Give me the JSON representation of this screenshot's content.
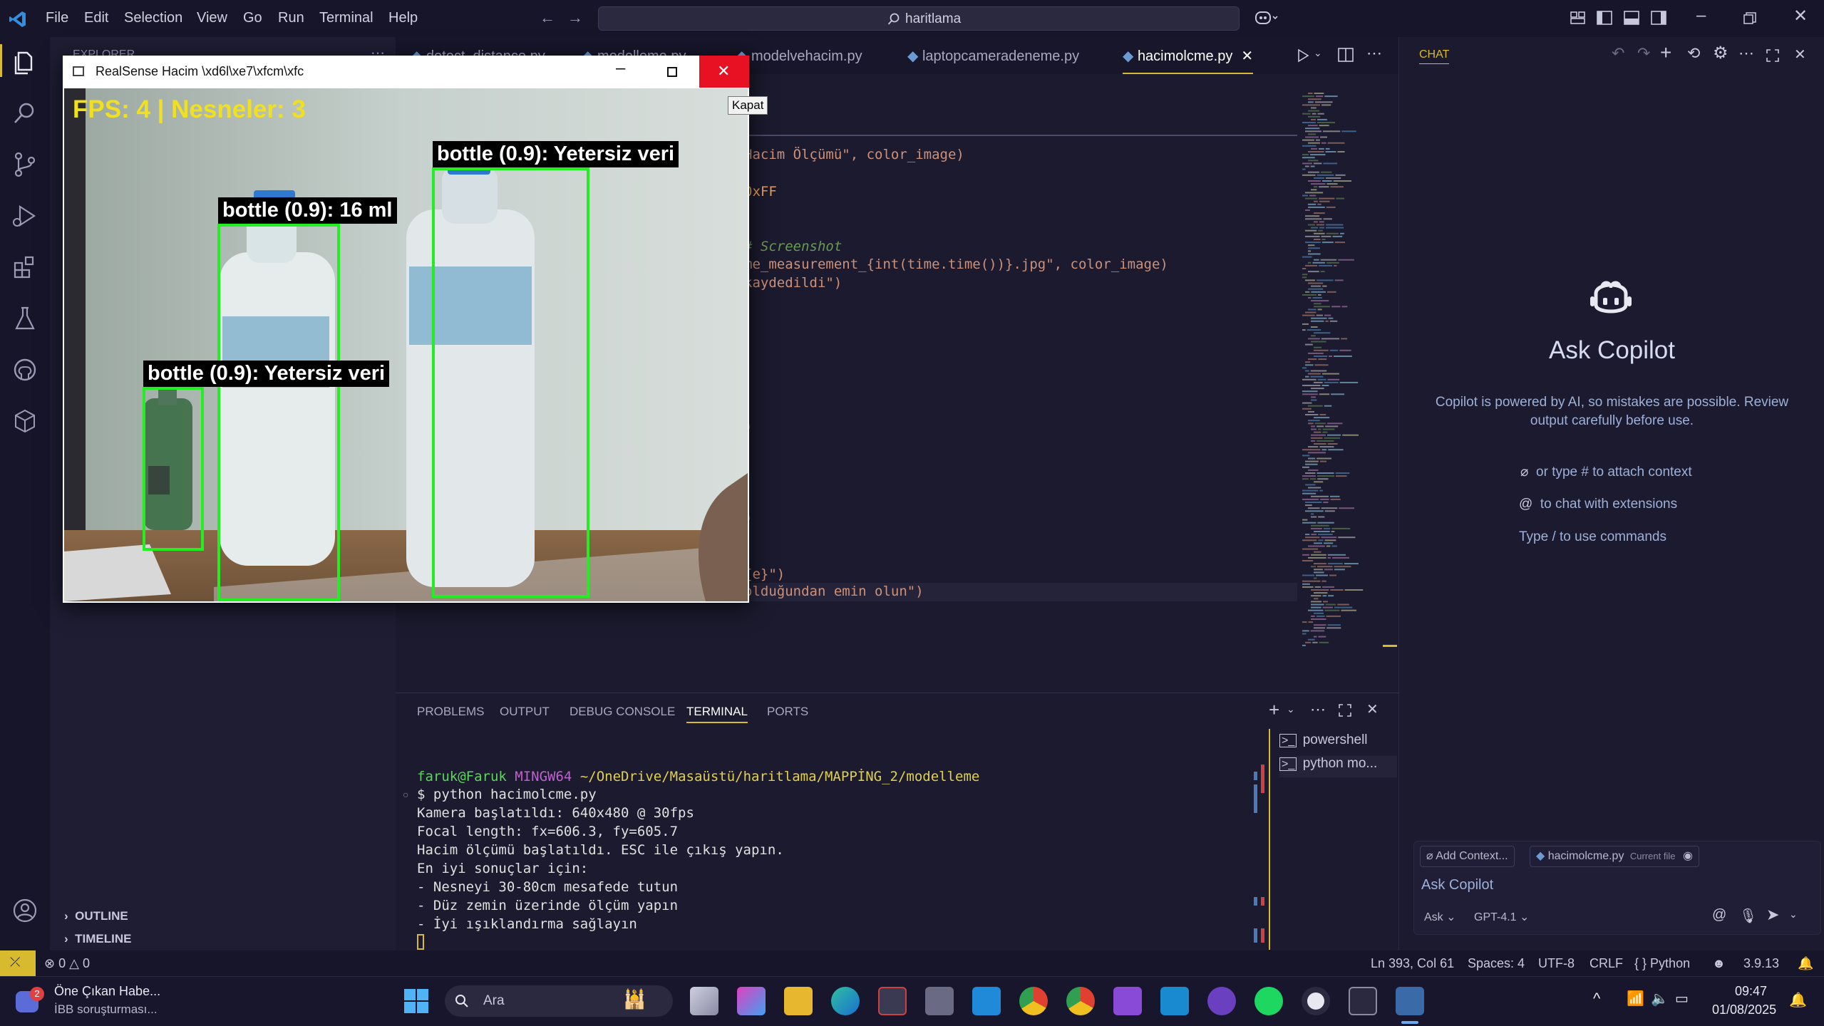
{
  "titlebar": {
    "menu": [
      "File",
      "Edit",
      "Selection",
      "View",
      "Go",
      "Run",
      "Terminal",
      "Help"
    ],
    "search_text": "haritlama"
  },
  "sidebar": {
    "header": "EXPLORER",
    "outline": "OUTLINE",
    "timeline": "TIMELINE"
  },
  "editor": {
    "tabs": [
      {
        "label": "detect_distance.py",
        "active": false
      },
      {
        "label": "modelleme.py",
        "active": false
      },
      {
        "label": "modelvehacim.py",
        "active": false
      },
      {
        "label": "laptopcameradeneme.py",
        "active": false
      },
      {
        "label": "hacimolcme.py",
        "active": true
      }
    ],
    "code_lines": [
      {
        "text": "Hacim Ölçümü\", color_image)"
      },
      {
        "text": "0xFF"
      },
      {
        "text": "# Screenshot"
      },
      {
        "text": "me_measurement_{int(time.time())}.jpg\", color_image)"
      },
      {
        "text": "kaydedildi\")"
      },
      {
        "text": ")"
      },
      {
        "text": ")"
      },
      {
        "text": "{e}\")"
      },
      {
        "text": "olduğundan emin olun\")"
      }
    ]
  },
  "panel": {
    "tabs": [
      "PROBLEMS",
      "OUTPUT",
      "DEBUG CONSOLE",
      "TERMINAL",
      "PORTS"
    ],
    "active_tab": "TERMINAL",
    "terminal": {
      "prompt_user": "faruk@Faruk",
      "prompt_host": "MINGW64",
      "prompt_path": "~/OneDrive/Masaüstü/haritlama/MAPPİNG_2/modelleme",
      "lines": [
        "$ python hacimolcme.py",
        "Kamera başlatıldı: 640x480 @ 30fps",
        "Focal length: fx=606.3, fy=605.7",
        "Hacim ölçümü başlatıldı. ESC ile çıkış yapın.",
        "En iyi sonuçlar için:",
        "- Nesneyi 30-80cm mesafede tutun",
        "- Düz zemin üzerinde ölçüm yapın",
        "- İyi ışıklandırma sağlayın"
      ],
      "shells": [
        "powershell",
        "python mo..."
      ]
    }
  },
  "chat": {
    "header": "CHAT",
    "title": "Ask Copilot",
    "description": "Copilot is powered by AI, so mistakes are possible. Review output carefully before use.",
    "hints": [
      "or type # to attach context",
      "to chat with extensions",
      "Type / to use commands"
    ],
    "add_context": "Add Context...",
    "current_file": "hacimolcme.py",
    "current_file_tag": "Current file",
    "input_placeholder": "Ask Copilot",
    "mode": "Ask",
    "model": "GPT-4.1"
  },
  "statusbar": {
    "errors": "0",
    "warnings": "0",
    "position": "Ln 393, Col 61",
    "spaces": "Spaces: 4",
    "encoding": "UTF-8",
    "eol": "CRLF",
    "language": "Python",
    "python_version": "3.9.13"
  },
  "realsense_window": {
    "title": "RealSense Hacim \\xd6l\\xe7\\xfcm\\xfc",
    "close_tooltip": "Kapat",
    "fps_text": "FPS: 4 | Nesneler: 3",
    "detections": [
      {
        "label": "bottle (0.9): Yetersiz veri"
      },
      {
        "label": "bottle (0.9): 16 ml"
      },
      {
        "label": "bottle (0.9): Yetersiz veri"
      }
    ]
  },
  "taskbar": {
    "news_badge": "2",
    "news_title": "Öne Çıkan Habe...",
    "news_sub": "İBB soruşturması...",
    "search": "Ara",
    "time": "09:47",
    "date": "01/08/2025"
  },
  "colors": {
    "accent_yellow": "#d7ba2e",
    "detection_green": "#22ee22",
    "close_red": "#e81123"
  }
}
